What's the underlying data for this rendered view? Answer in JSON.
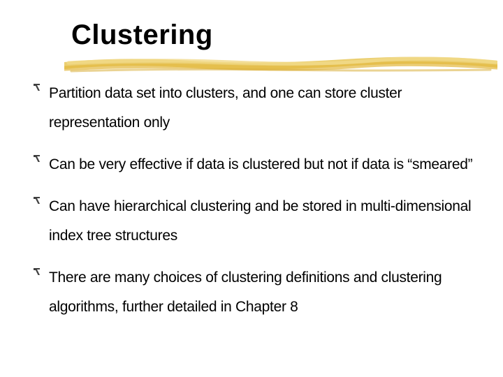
{
  "slide": {
    "title": "Clustering",
    "bullets": [
      "Partition data set into clusters, and one can store cluster representation only",
      "Can be very effective if data is clustered but not if data is “smeared”",
      "Can have hierarchical clustering and be stored in multi-dimensional index tree structures",
      "There are many choices of clustering definitions and clustering algorithms, further detailed in Chapter 8"
    ]
  }
}
